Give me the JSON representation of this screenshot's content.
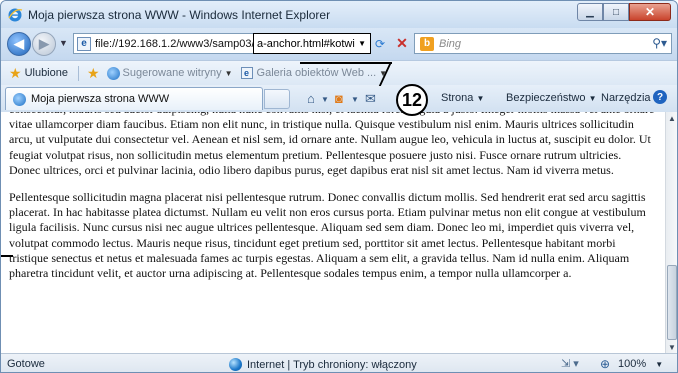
{
  "window": {
    "title": "Moja pierwsza strona WWW - Windows Internet Explorer"
  },
  "address": {
    "url_prefix": "file://192.168.1.2/www3/samp03/",
    "url_highlight": "a-anchor.html#kotwi",
    "search_placeholder": "Bing"
  },
  "favorites": {
    "favorites_label": "Ulubione",
    "suggested_sites": "Sugerowane witryny",
    "web_slice_gallery": "Galeria obiektów Web ..."
  },
  "tab": {
    "label": "Moja pierwsza strona WWW"
  },
  "commands": {
    "page": "Strona",
    "safety": "Bezpieczeństwo",
    "tools": "Narzędzia"
  },
  "callout_number": "12",
  "content": {
    "paragraph1": "consectetur, mauris sed auctor adipiscing, nulla nunc convallis nisi, et lacinia lorem ligula a justo. Integer mollis massa vel ante ornare vitae ullamcorper diam faucibus. Etiam non elit nunc, in tristique nulla. Quisque vestibulum nisl enim. Mauris ultrices sollicitudin arcu, ut vulputate dui consectetur vel. Aenean et nisl sem, id ornare ante. Nullam augue leo, vehicula in luctus at, suscipit eu dolor. Ut feugiat volutpat risus, non sollicitudin metus elementum pretium. Pellentesque posuere justo nisi. Fusce ornare rutrum ultricies. Donec ultrices, orci et pulvinar lacinia, odio libero dapibus purus, eget dapibus erat nisl sit amet lectus. Nam id viverra metus.",
    "paragraph2": "Pellentesque sollicitudin magna placerat nisi pellentesque rutrum. Donec convallis dictum mollis. Sed hendrerit erat sed arcu sagittis placerat. In hac habitasse platea dictumst. Nullam eu velit non eros cursus porta. Etiam pulvinar metus non elit congue at vestibulum ligula facilisis. Nunc cursus nisi nec augue ultrices pellentesque. Aliquam sed sem diam. Donec leo mi, imperdiet quis viverra vel, volutpat commodo lectus. Mauris neque risus, tincidunt eget pretium sed, porttitor sit amet lectus. Pellentesque habitant morbi tristique senectus et netus et malesuada fames ac turpis egestas. Aliquam a sem elit, a gravida tellus. Nam id nulla enim. Aliquam pharetra tincidunt velit, et auctor urna adipiscing at. Pellentesque sodales tempus enim, a tempor nulla ullamcorper a."
  },
  "status": {
    "text": "Gotowe",
    "zone": "Internet | Tryb chroniony: włączony",
    "zoom": "100%"
  },
  "icons": {
    "browser": "ie-icon",
    "back": "back-arrow-icon",
    "forward": "forward-arrow-icon",
    "refresh": "refresh-icon",
    "stop": "stop-icon",
    "search": "search-icon",
    "favorites": "star-icon",
    "home": "home-icon",
    "feeds": "feeds-icon",
    "mail": "mail-icon",
    "help": "help-icon",
    "zone": "globe-icon",
    "zoom": "zoom-icon"
  }
}
